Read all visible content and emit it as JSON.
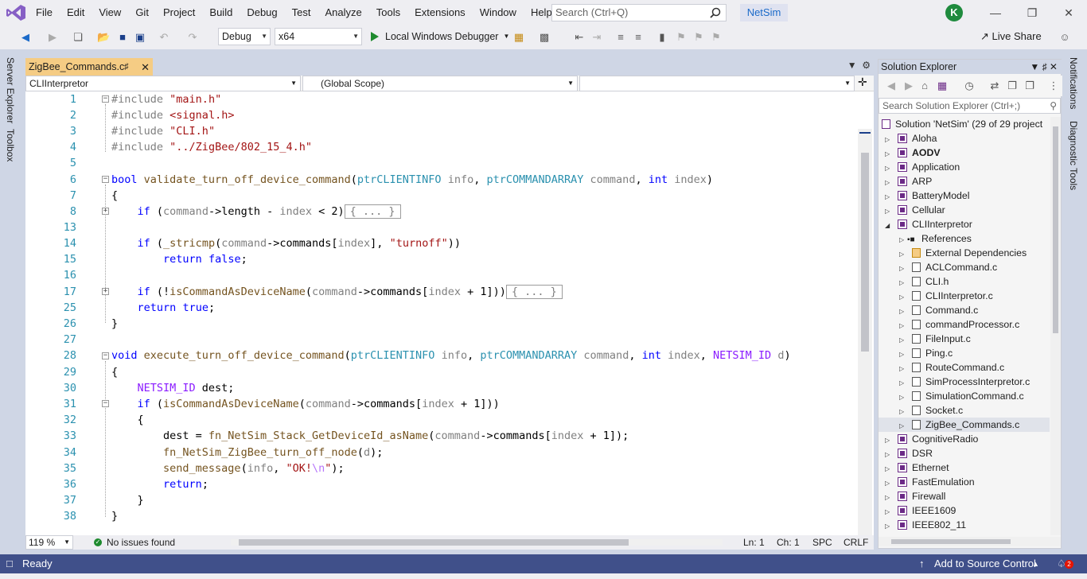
{
  "menubar": {
    "items": [
      "File",
      "Edit",
      "View",
      "Git",
      "Project",
      "Build",
      "Debug",
      "Test",
      "Analyze",
      "Tools",
      "Extensions",
      "Window",
      "Help"
    ],
    "search_placeholder": "Search (Ctrl+Q)",
    "solution_badge": "NetSim",
    "avatar_initial": "K"
  },
  "toolbar": {
    "config": "Debug",
    "platform": "x64",
    "run_label": "Local Windows Debugger",
    "live_share": "Live Share"
  },
  "left_tabs": [
    "Server Explorer",
    "Toolbox"
  ],
  "right_tabs": [
    "Notifications",
    "Diagnostic Tools"
  ],
  "editor": {
    "tab_title": "ZigBee_Commands.c",
    "nav_project": "CLIInterpretor",
    "nav_scope": "(Global Scope)",
    "nav_member": "",
    "line_numbers": [
      "1",
      "2",
      "3",
      "4",
      "5",
      "6",
      "7",
      "8",
      "13",
      "14",
      "15",
      "16",
      "17",
      "25",
      "26",
      "27",
      "28",
      "29",
      "30",
      "31",
      "32",
      "33",
      "34",
      "35",
      "36",
      "37",
      "38"
    ],
    "zoom": "119 %",
    "issues": "No issues found",
    "ln": "Ln: 1",
    "ch": "Ch: 1",
    "spc": "SPC",
    "crlf": "CRLF"
  },
  "solution_explorer": {
    "title": "Solution Explorer",
    "search_placeholder": "Search Solution Explorer (Ctrl+;)",
    "solution_label": "Solution 'NetSim' (29 of 29 project",
    "projects_top": [
      "Aloha",
      "AODV",
      "Application",
      "ARP",
      "BatteryModel",
      "Cellular",
      "CLIInterpretor"
    ],
    "cli_children": [
      "References",
      "External Dependencies",
      "ACLCommand.c",
      "CLI.h",
      "CLIInterpretor.c",
      "Command.c",
      "commandProcessor.c",
      "FileInput.c",
      "Ping.c",
      "RouteCommand.c",
      "SimProcessInterpretor.c",
      "SimulationCommand.c",
      "Socket.c",
      "ZigBee_Commands.c"
    ],
    "projects_bottom": [
      "CognitiveRadio",
      "DSR",
      "Ethernet",
      "FastEmulation",
      "Firewall",
      "IEEE1609",
      "IEEE802_11"
    ]
  },
  "statusbar": {
    "ready": "Ready",
    "source_control": "Add to Source Control",
    "notif_count": "2"
  }
}
